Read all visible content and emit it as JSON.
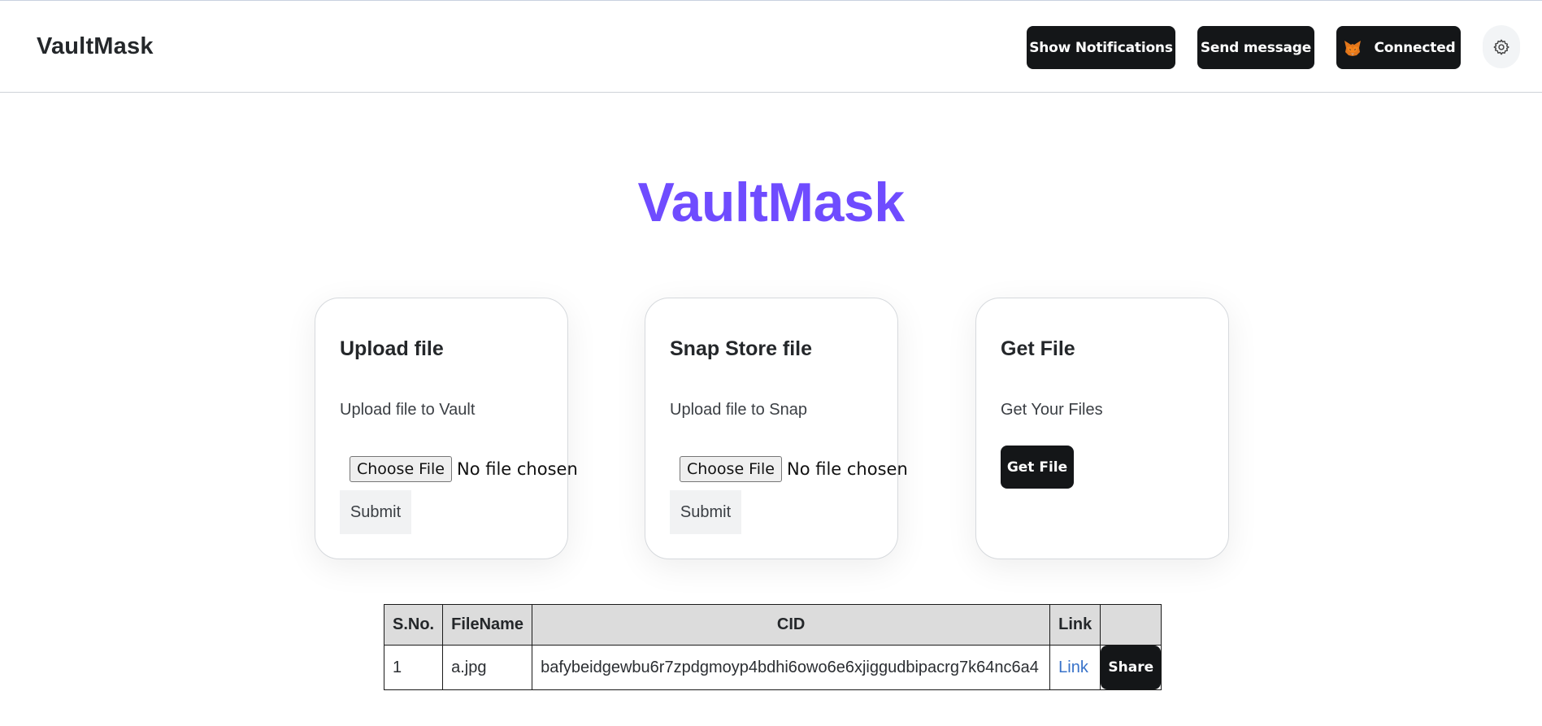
{
  "header": {
    "brand": "VaultMask",
    "buttons": {
      "notifications": "Show Notifications",
      "send": "Send message",
      "connected": "Connected"
    }
  },
  "hero": {
    "title": "VaultMask"
  },
  "cards": [
    {
      "title": "Upload file",
      "description": "Upload file to Vault",
      "choose_label": "Choose File",
      "file_status": "No file chosen",
      "submit_label": "Submit"
    },
    {
      "title": "Snap Store file",
      "description": "Upload file to Snap",
      "choose_label": "Choose File",
      "file_status": "No file chosen",
      "submit_label": "Submit"
    },
    {
      "title": "Get File",
      "description": "Get Your Files",
      "button_label": "Get File"
    }
  ],
  "table": {
    "headers": [
      "S.No.",
      "FileName",
      "CID",
      "Link",
      ""
    ],
    "rows": [
      {
        "sno": "1",
        "filename": "a.jpg",
        "cid": "bafybeidgewbu6r7zpdgmoyp4bdhi6owo6e6xjiggudbipacrg7k64nc6a4",
        "link": "Link",
        "share": "Share"
      }
    ]
  },
  "colors": {
    "accent": "#6f4cff",
    "button_dark": "#141618",
    "link": "#3872c9"
  },
  "icons": {
    "connected": "metamask-fox-icon",
    "settings": "gear-icon"
  }
}
